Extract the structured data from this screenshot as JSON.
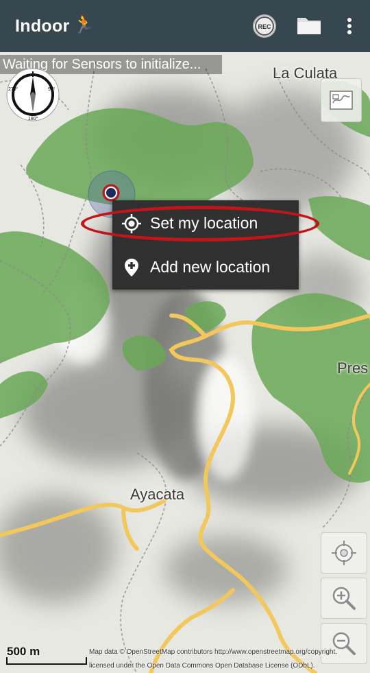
{
  "appbar": {
    "title": "Indoor",
    "runner_icon": "running-person-icon",
    "actions": [
      {
        "name": "rec-button",
        "label": "REC"
      },
      {
        "name": "folder-button",
        "icon": "folder-icon"
      },
      {
        "name": "overflow-menu-button",
        "icon": "more-vert-icon"
      }
    ],
    "color": "#37474f"
  },
  "status": {
    "text": "Waiting for Sensors to initialize..."
  },
  "map": {
    "places": {
      "la_culata": "La Culata",
      "ayacata": "Ayacata",
      "pres": "Pres"
    },
    "compass": {
      "left_label": "270°",
      "right_label": "90°",
      "bottom_label": "180°"
    },
    "scale_label": "500 m",
    "attribution_line1": "Map data © OpenStreetMap contributors http://www.openstreetmap.org/copyright.",
    "attribution_line2": "licensed under the Open Data Commons Open Database License (ODbL).",
    "colors": {
      "forest": "#6aa857",
      "road": "#f2c75c",
      "path": "#8a8a8a",
      "highlight": "#c2151a"
    }
  },
  "context_menu": {
    "items": [
      {
        "label": "Set my location",
        "icon": "crosshair-target-icon"
      },
      {
        "label": "Add new location",
        "icon": "add-location-pin-icon"
      }
    ]
  },
  "map_buttons": [
    {
      "name": "map-layers-button",
      "icon": "map-icon"
    },
    {
      "name": "my-location-button",
      "icon": "gps-target-icon"
    },
    {
      "name": "zoom-in-button",
      "icon": "zoom-in-icon"
    },
    {
      "name": "zoom-out-button",
      "icon": "zoom-out-icon"
    }
  ]
}
